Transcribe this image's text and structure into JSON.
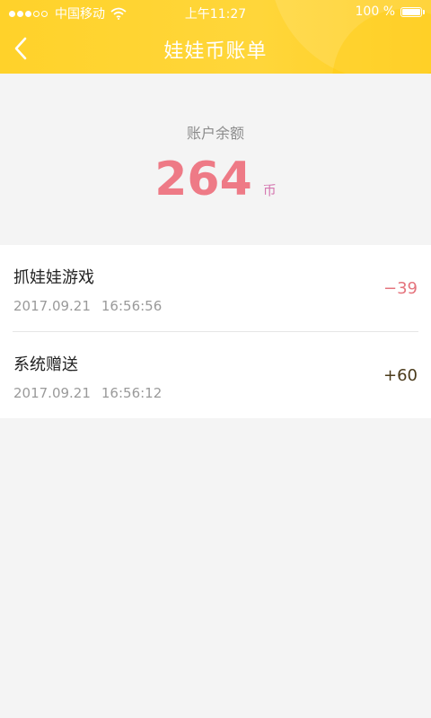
{
  "status_bar": {
    "carrier": "中国移动",
    "time": "上午11:27",
    "battery": "100 %"
  },
  "nav": {
    "title": "娃娃币账单",
    "back_icon": "chevron-left-icon"
  },
  "balance": {
    "label": "账户余额",
    "value": "264",
    "unit": "币"
  },
  "transactions": [
    {
      "title": "抓娃娃游戏",
      "date": "2017.09.21",
      "time": "16:56:56",
      "amount": "−39"
    },
    {
      "title": "系统赠送",
      "date": "2017.09.21",
      "time": "16:56:12",
      "amount": "+60"
    }
  ],
  "colors": {
    "header": "#ffd22a",
    "balance_value": "#ee7a86",
    "negative": "#e5747d",
    "positive": "#4a3a1a"
  }
}
